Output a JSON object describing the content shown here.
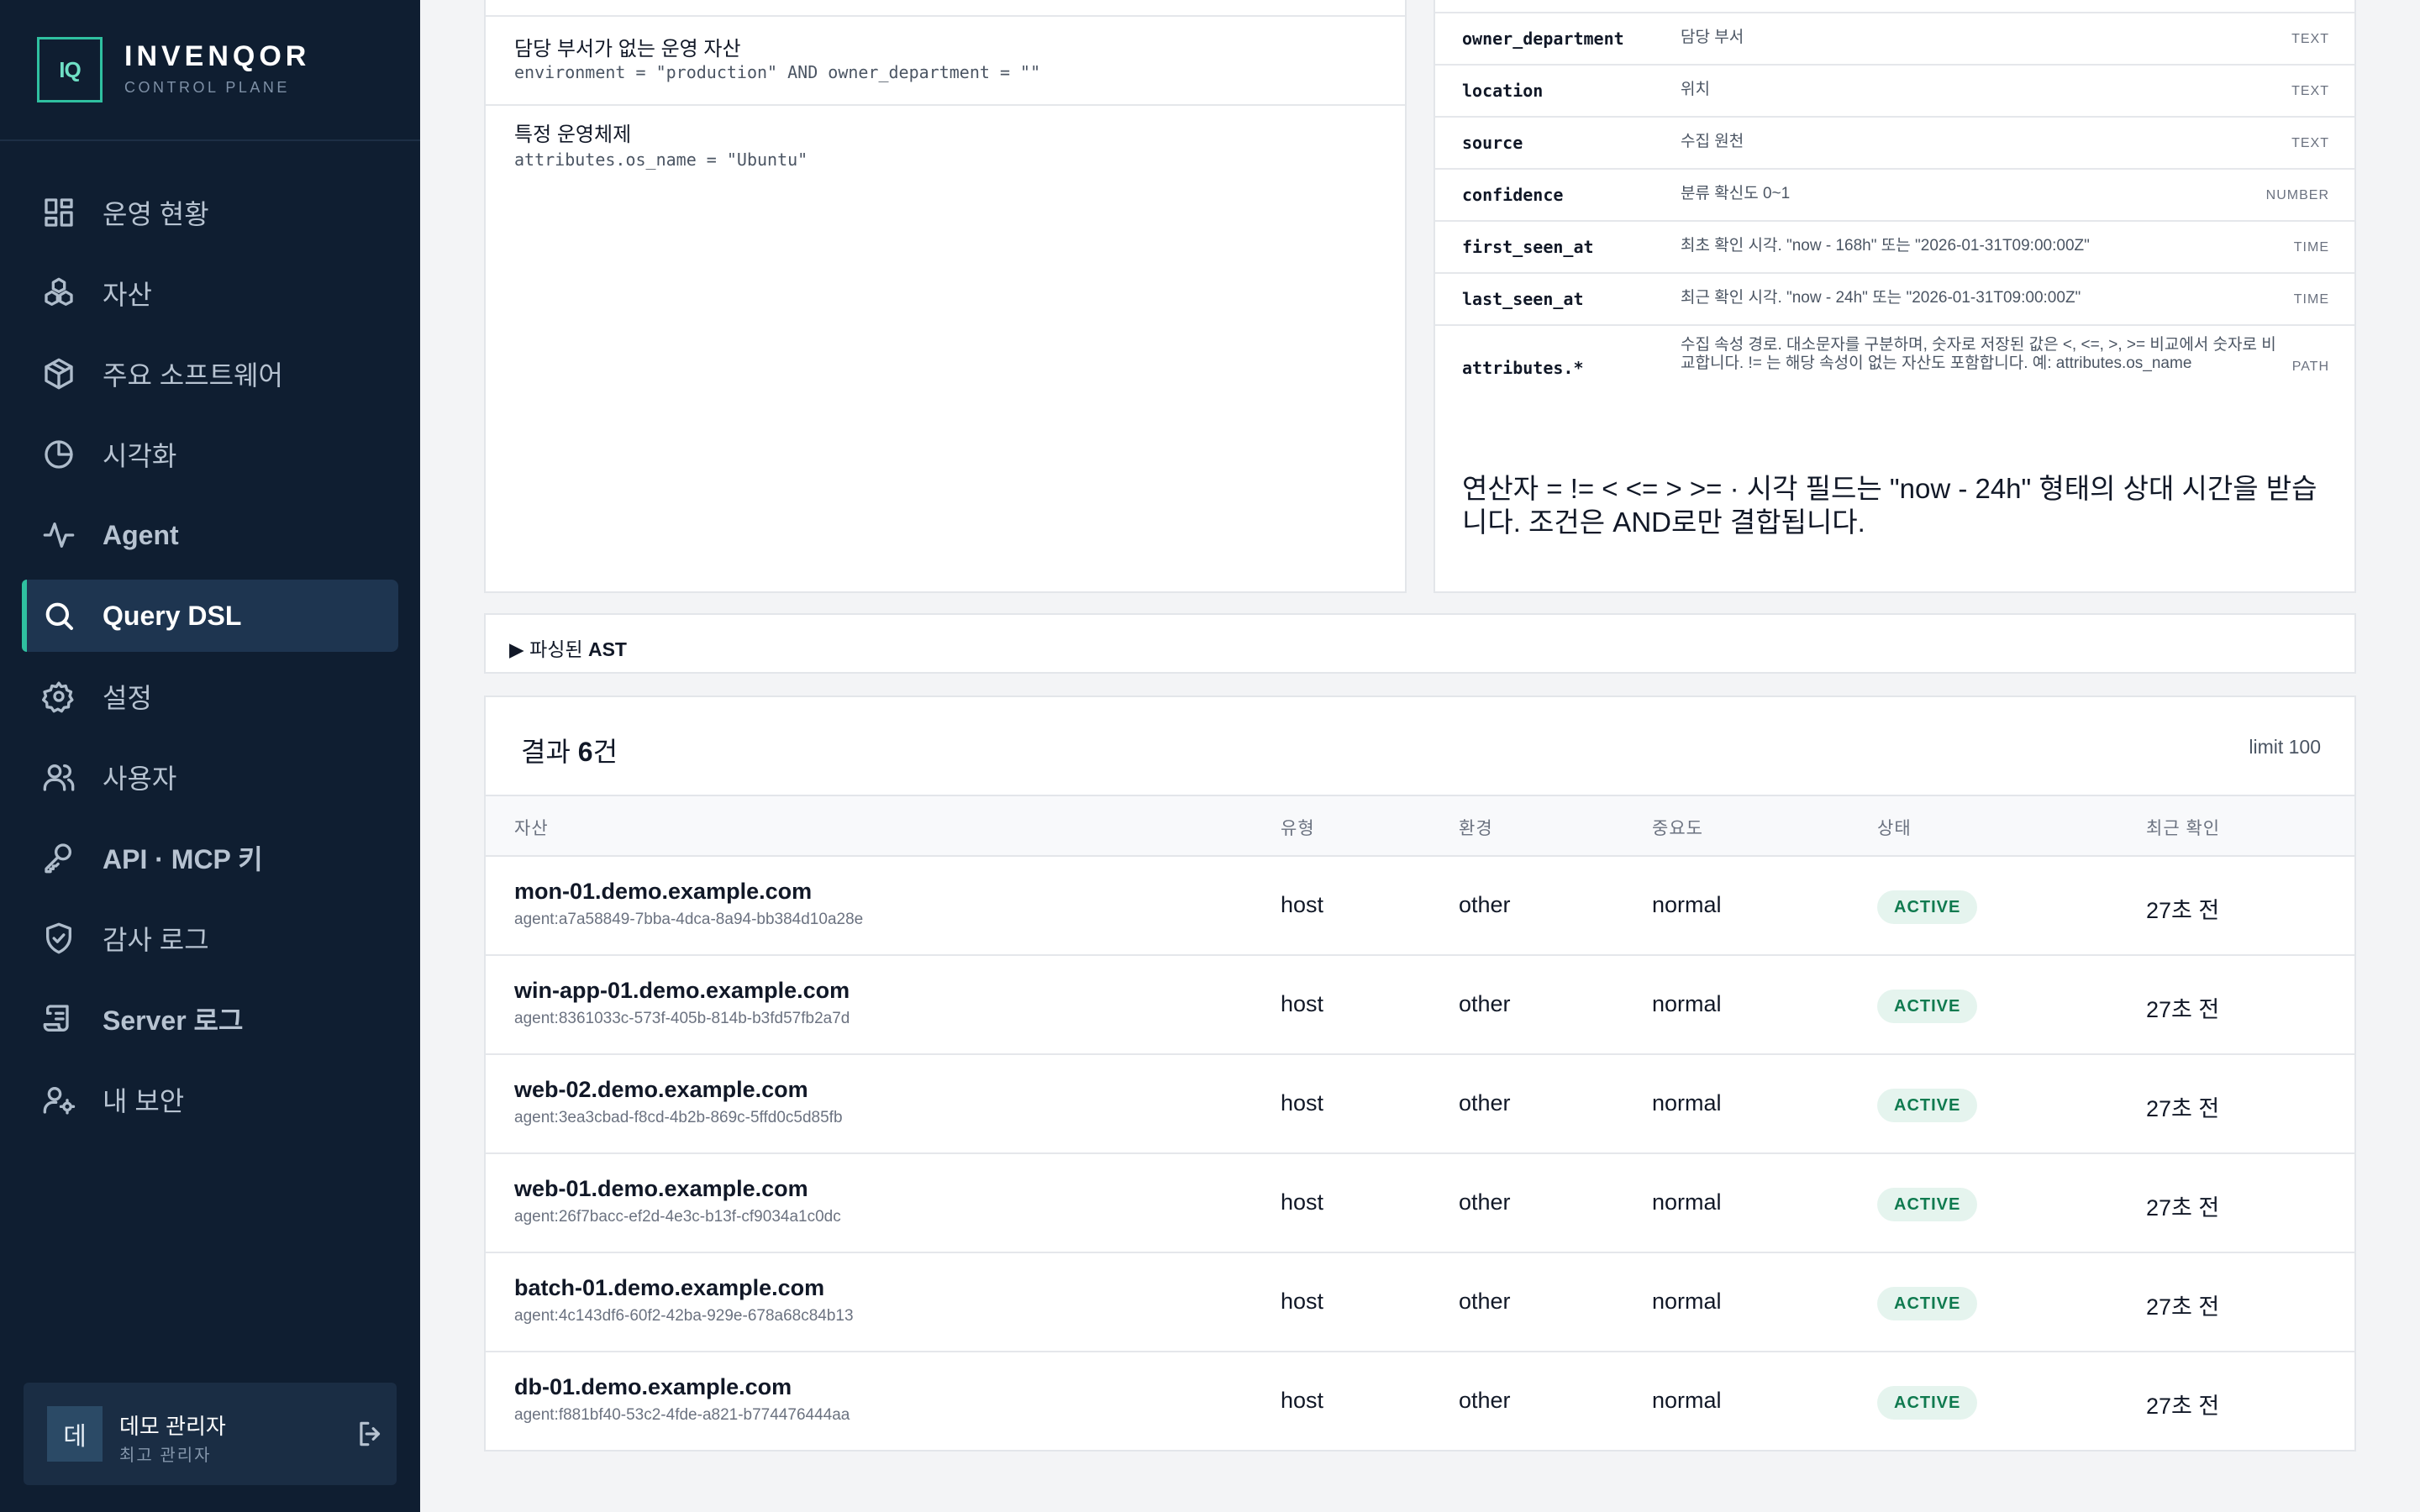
{
  "brand": {
    "logo": "IQ",
    "name": "INVENQOR",
    "sub": "CONTROL PLANE"
  },
  "nav": [
    {
      "label": "운영 현황",
      "icon": "dashboard-icon",
      "active": false
    },
    {
      "label": "자산",
      "icon": "assets-icon",
      "active": false
    },
    {
      "label": "주요 소프트웨어",
      "icon": "package-icon",
      "active": false
    },
    {
      "label": "시각화",
      "icon": "pie-chart-icon",
      "active": false
    },
    {
      "label": "Agent",
      "icon": "activity-icon",
      "active": false
    },
    {
      "label": "Query DSL",
      "icon": "search-icon",
      "active": true
    },
    {
      "label": "설정",
      "icon": "gear-icon",
      "active": false
    },
    {
      "label": "사용자",
      "icon": "users-icon",
      "active": false
    },
    {
      "label": "API · MCP 키",
      "icon": "key-icon",
      "active": false
    },
    {
      "label": "감사 로그",
      "icon": "shield-check-icon",
      "active": false
    },
    {
      "label": "Server 로그",
      "icon": "scroll-icon",
      "active": false
    },
    {
      "label": "내 보안",
      "icon": "user-cog-icon",
      "active": false
    }
  ],
  "user": {
    "avatar": "데",
    "name": "데모 관리자",
    "role": "최고 관리자"
  },
  "examples": [
    {
      "title": "담당 부서가 없는 운영 자산",
      "code": "environment = \"production\" AND owner_department = \"\""
    },
    {
      "title": "특정 운영체제",
      "code": "attributes.os_name = \"Ubuntu\""
    }
  ],
  "fields": [
    {
      "key": "owner_department",
      "desc": "담당 부서",
      "type": "TEXT"
    },
    {
      "key": "location",
      "desc": "위치",
      "type": "TEXT"
    },
    {
      "key": "source",
      "desc": "수집 원천",
      "type": "TEXT"
    },
    {
      "key": "confidence",
      "desc": "분류 확신도 0~1",
      "type": "NUMBER"
    },
    {
      "key": "first_seen_at",
      "desc": "최초 확인 시각. \"now - 168h\" 또는 \"2026-01-31T09:00:00Z\"",
      "type": "TIME"
    },
    {
      "key": "last_seen_at",
      "desc": "최근 확인 시각. \"now - 24h\" 또는 \"2026-01-31T09:00:00Z\"",
      "type": "TIME"
    },
    {
      "key": "attributes.*",
      "desc": "수집 속성 경로. 대소문자를 구분하며, 숫자로 저장된 값은 <, <=, >, >= 비교에서 숫자로 비교합니다. != 는 해당 속성이 없는 자산도 포함합니다. 예: attributes.os_name",
      "type": "PATH"
    }
  ],
  "ops_note": "연산자 = != < <= > >= · 시각 필드는 \"now - 24h\" 형태의 상대 시간을 받습니다. 조건은 AND로만 결합됩니다.",
  "ast": {
    "prefix": "▶ 파싱된 ",
    "strong": "AST"
  },
  "results": {
    "title_prefix": "결과 ",
    "count": "6",
    "title_suffix": "건",
    "limit": "limit 100",
    "columns": [
      "자산",
      "유형",
      "환경",
      "중요도",
      "상태",
      "최근 확인"
    ],
    "rows": [
      {
        "host": "mon-01.demo.example.com",
        "agent": "agent:a7a58849-7bba-4dca-8a94-bb384d10a28e",
        "type": "host",
        "env": "other",
        "criticality": "normal",
        "status": "ACTIVE",
        "seen": "27초 전"
      },
      {
        "host": "win-app-01.demo.example.com",
        "agent": "agent:8361033c-573f-405b-814b-b3fd57fb2a7d",
        "type": "host",
        "env": "other",
        "criticality": "normal",
        "status": "ACTIVE",
        "seen": "27초 전"
      },
      {
        "host": "web-02.demo.example.com",
        "agent": "agent:3ea3cbad-f8cd-4b2b-869c-5ffd0c5d85fb",
        "type": "host",
        "env": "other",
        "criticality": "normal",
        "status": "ACTIVE",
        "seen": "27초 전"
      },
      {
        "host": "web-01.demo.example.com",
        "agent": "agent:26f7bacc-ef2d-4e3c-b13f-cf9034a1c0dc",
        "type": "host",
        "env": "other",
        "criticality": "normal",
        "status": "ACTIVE",
        "seen": "27초 전"
      },
      {
        "host": "batch-01.demo.example.com",
        "agent": "agent:4c143df6-60f2-42ba-929e-678a68c84b13",
        "type": "host",
        "env": "other",
        "criticality": "normal",
        "status": "ACTIVE",
        "seen": "27초 전"
      },
      {
        "host": "db-01.demo.example.com",
        "agent": "agent:f881bf40-53c2-4fde-a821-b774476444aa",
        "type": "host",
        "env": "other",
        "criticality": "normal",
        "status": "ACTIVE",
        "seen": "27초 전"
      }
    ]
  }
}
